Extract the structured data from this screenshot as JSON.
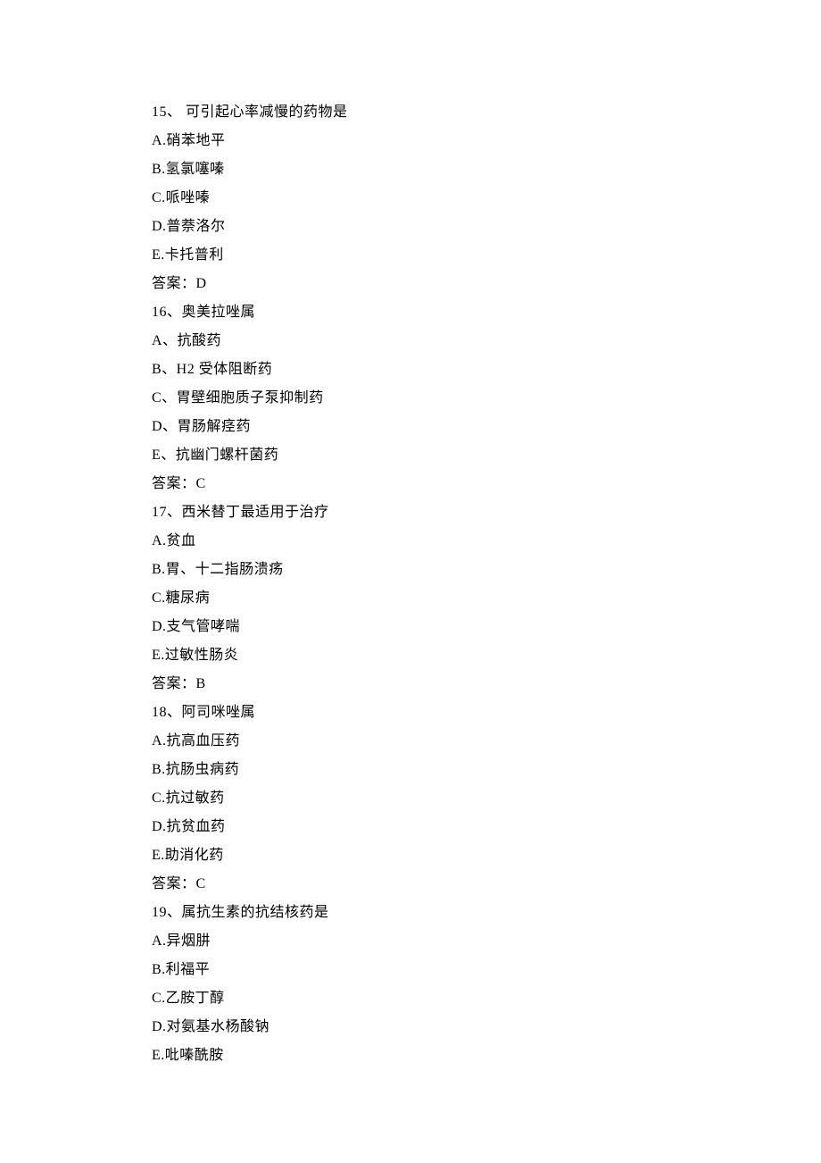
{
  "questions": [
    {
      "stem": "15、 可引起心率减慢的药物是",
      "options": [
        "A.硝苯地平",
        "B.氢氯噻嗪",
        "C.哌唑嗪",
        "D.普萘洛尔",
        "E.卡托普利"
      ],
      "answer": "答案：D"
    },
    {
      "stem": "16、奥美拉唑属",
      "options": [
        "A、抗酸药",
        "B、H2 受体阻断药",
        "C、胃壁细胞质子泵抑制药",
        "D、胃肠解痉药",
        "E、抗幽门螺杆菌药"
      ],
      "answer": "答案：C"
    },
    {
      "stem": "17、西米替丁最适用于治疗",
      "options": [
        "A.贫血",
        "B.胃、十二指肠溃疡",
        "C.糖尿病",
        "D.支气管哮喘",
        "E.过敏性肠炎"
      ],
      "answer": "答案：B"
    },
    {
      "stem": "18、阿司咪唑属",
      "options": [
        "A.抗高血压药",
        "B.抗肠虫病药",
        "C.抗过敏药",
        "D.抗贫血药",
        "E.助消化药"
      ],
      "answer": "答案：C"
    },
    {
      "stem": "19、属抗生素的抗结核药是",
      "options": [
        "A.异烟肼",
        "B.利福平",
        "C.乙胺丁醇",
        "D.对氨基水杨酸钠",
        "E.吡嗪酰胺"
      ],
      "answer": ""
    }
  ]
}
